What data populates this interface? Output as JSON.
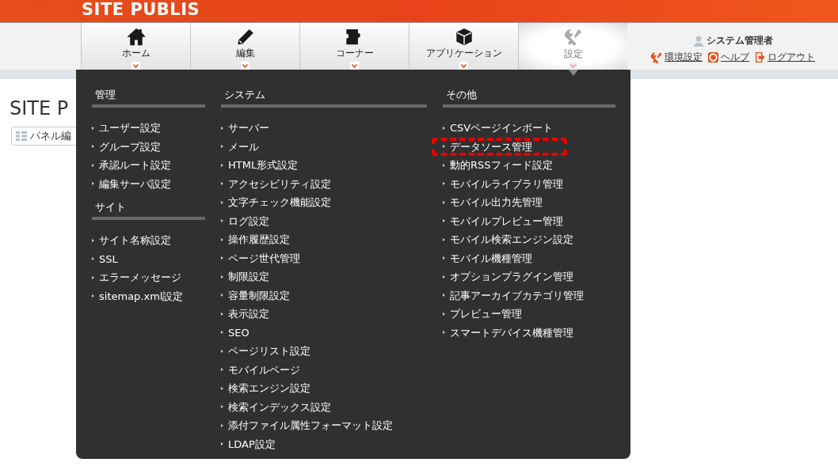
{
  "header": {
    "logo": "SITE PUBLIS"
  },
  "nav": {
    "tabs": [
      {
        "label": "ホーム",
        "selected": false
      },
      {
        "label": "編集",
        "selected": false
      },
      {
        "label": "コーナー",
        "selected": false
      },
      {
        "label": "アプリケーション",
        "selected": false
      },
      {
        "label": "設定",
        "selected": true
      }
    ],
    "user": {
      "name": "システム管理者",
      "links": [
        "環境設定",
        "ヘルプ",
        "ログアウト"
      ]
    }
  },
  "page": {
    "title": "SITE P",
    "panel_button": "パネル編"
  },
  "menu": {
    "columns": [
      {
        "sections": [
          {
            "heading": "管理",
            "items": [
              {
                "label": "ユーザー設定",
                "highlighted": false
              },
              {
                "label": "グループ設定",
                "highlighted": false
              },
              {
                "label": "承認ルート設定",
                "highlighted": false
              },
              {
                "label": "編集サーバ設定",
                "highlighted": false
              }
            ]
          },
          {
            "heading": "サイト",
            "items": [
              {
                "label": "サイト名称設定",
                "highlighted": false
              },
              {
                "label": "SSL",
                "highlighted": false
              },
              {
                "label": "エラーメッセージ",
                "highlighted": false
              },
              {
                "label": "sitemap.xml設定",
                "highlighted": false
              }
            ]
          }
        ]
      },
      {
        "sections": [
          {
            "heading": "システム",
            "items": [
              {
                "label": "サーバー",
                "highlighted": false
              },
              {
                "label": "メール",
                "highlighted": false
              },
              {
                "label": "HTML形式設定",
                "highlighted": false
              },
              {
                "label": "アクセシビリティ設定",
                "highlighted": false
              },
              {
                "label": "文字チェック機能設定",
                "highlighted": false
              },
              {
                "label": "ログ設定",
                "highlighted": false
              },
              {
                "label": "操作履歴設定",
                "highlighted": false
              },
              {
                "label": "ページ世代管理",
                "highlighted": false
              },
              {
                "label": "制限設定",
                "highlighted": false
              },
              {
                "label": "容量制限設定",
                "highlighted": false
              },
              {
                "label": "表示設定",
                "highlighted": false
              },
              {
                "label": "SEO",
                "highlighted": false
              },
              {
                "label": "ページリスト設定",
                "highlighted": false
              },
              {
                "label": "モバイルページ",
                "highlighted": false
              },
              {
                "label": "検索エンジン設定",
                "highlighted": false
              },
              {
                "label": "検索インデックス設定",
                "highlighted": false
              },
              {
                "label": "添付ファイル属性フォーマット設定",
                "highlighted": false
              },
              {
                "label": "LDAP設定",
                "highlighted": false
              }
            ]
          }
        ]
      },
      {
        "sections": [
          {
            "heading": "その他",
            "items": [
              {
                "label": "CSVページインポート",
                "highlighted": false
              },
              {
                "label": "データソース管理",
                "highlighted": true
              },
              {
                "label": "動的RSSフィード設定",
                "highlighted": false
              },
              {
                "label": "モバイルライブラリ管理",
                "highlighted": false
              },
              {
                "label": "モバイル出力先管理",
                "highlighted": false
              },
              {
                "label": "モバイルプレビュー管理",
                "highlighted": false
              },
              {
                "label": "モバイル検索エンジン設定",
                "highlighted": false
              },
              {
                "label": "モバイル機種管理",
                "highlighted": false
              },
              {
                "label": "オプションプラグイン管理",
                "highlighted": false
              },
              {
                "label": "記事アーカイブカテゴリ管理",
                "highlighted": false
              },
              {
                "label": "プレビュー管理",
                "highlighted": false
              },
              {
                "label": "スマートデバイス機種管理",
                "highlighted": false
              }
            ]
          }
        ]
      }
    ]
  }
}
